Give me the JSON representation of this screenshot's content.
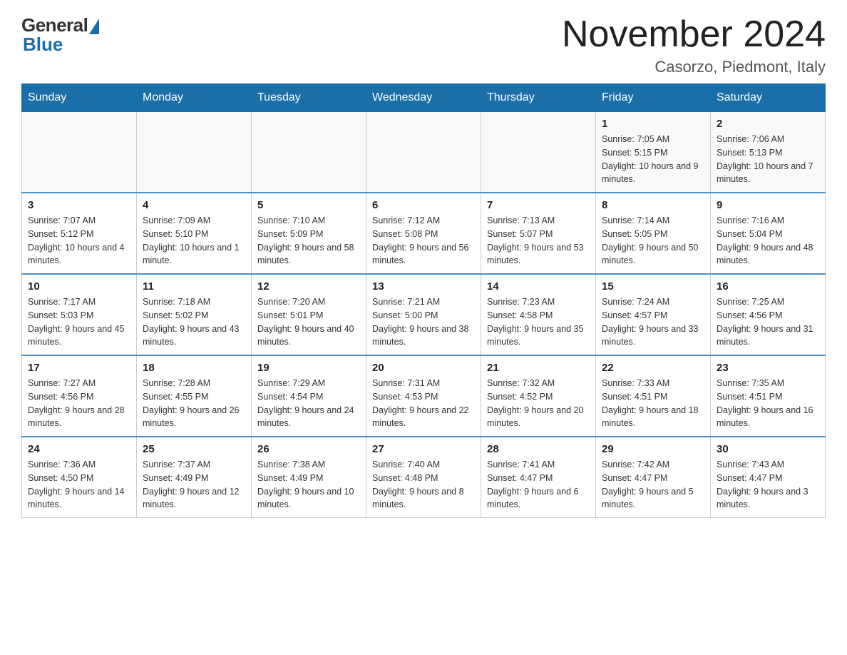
{
  "header": {
    "logo_general": "General",
    "logo_blue": "Blue",
    "month_title": "November 2024",
    "location": "Casorzo, Piedmont, Italy"
  },
  "weekdays": [
    "Sunday",
    "Monday",
    "Tuesday",
    "Wednesday",
    "Thursday",
    "Friday",
    "Saturday"
  ],
  "weeks": [
    [
      {
        "day": "",
        "info": ""
      },
      {
        "day": "",
        "info": ""
      },
      {
        "day": "",
        "info": ""
      },
      {
        "day": "",
        "info": ""
      },
      {
        "day": "",
        "info": ""
      },
      {
        "day": "1",
        "info": "Sunrise: 7:05 AM\nSunset: 5:15 PM\nDaylight: 10 hours and 9 minutes."
      },
      {
        "day": "2",
        "info": "Sunrise: 7:06 AM\nSunset: 5:13 PM\nDaylight: 10 hours and 7 minutes."
      }
    ],
    [
      {
        "day": "3",
        "info": "Sunrise: 7:07 AM\nSunset: 5:12 PM\nDaylight: 10 hours and 4 minutes."
      },
      {
        "day": "4",
        "info": "Sunrise: 7:09 AM\nSunset: 5:10 PM\nDaylight: 10 hours and 1 minute."
      },
      {
        "day": "5",
        "info": "Sunrise: 7:10 AM\nSunset: 5:09 PM\nDaylight: 9 hours and 58 minutes."
      },
      {
        "day": "6",
        "info": "Sunrise: 7:12 AM\nSunset: 5:08 PM\nDaylight: 9 hours and 56 minutes."
      },
      {
        "day": "7",
        "info": "Sunrise: 7:13 AM\nSunset: 5:07 PM\nDaylight: 9 hours and 53 minutes."
      },
      {
        "day": "8",
        "info": "Sunrise: 7:14 AM\nSunset: 5:05 PM\nDaylight: 9 hours and 50 minutes."
      },
      {
        "day": "9",
        "info": "Sunrise: 7:16 AM\nSunset: 5:04 PM\nDaylight: 9 hours and 48 minutes."
      }
    ],
    [
      {
        "day": "10",
        "info": "Sunrise: 7:17 AM\nSunset: 5:03 PM\nDaylight: 9 hours and 45 minutes."
      },
      {
        "day": "11",
        "info": "Sunrise: 7:18 AM\nSunset: 5:02 PM\nDaylight: 9 hours and 43 minutes."
      },
      {
        "day": "12",
        "info": "Sunrise: 7:20 AM\nSunset: 5:01 PM\nDaylight: 9 hours and 40 minutes."
      },
      {
        "day": "13",
        "info": "Sunrise: 7:21 AM\nSunset: 5:00 PM\nDaylight: 9 hours and 38 minutes."
      },
      {
        "day": "14",
        "info": "Sunrise: 7:23 AM\nSunset: 4:58 PM\nDaylight: 9 hours and 35 minutes."
      },
      {
        "day": "15",
        "info": "Sunrise: 7:24 AM\nSunset: 4:57 PM\nDaylight: 9 hours and 33 minutes."
      },
      {
        "day": "16",
        "info": "Sunrise: 7:25 AM\nSunset: 4:56 PM\nDaylight: 9 hours and 31 minutes."
      }
    ],
    [
      {
        "day": "17",
        "info": "Sunrise: 7:27 AM\nSunset: 4:56 PM\nDaylight: 9 hours and 28 minutes."
      },
      {
        "day": "18",
        "info": "Sunrise: 7:28 AM\nSunset: 4:55 PM\nDaylight: 9 hours and 26 minutes."
      },
      {
        "day": "19",
        "info": "Sunrise: 7:29 AM\nSunset: 4:54 PM\nDaylight: 9 hours and 24 minutes."
      },
      {
        "day": "20",
        "info": "Sunrise: 7:31 AM\nSunset: 4:53 PM\nDaylight: 9 hours and 22 minutes."
      },
      {
        "day": "21",
        "info": "Sunrise: 7:32 AM\nSunset: 4:52 PM\nDaylight: 9 hours and 20 minutes."
      },
      {
        "day": "22",
        "info": "Sunrise: 7:33 AM\nSunset: 4:51 PM\nDaylight: 9 hours and 18 minutes."
      },
      {
        "day": "23",
        "info": "Sunrise: 7:35 AM\nSunset: 4:51 PM\nDaylight: 9 hours and 16 minutes."
      }
    ],
    [
      {
        "day": "24",
        "info": "Sunrise: 7:36 AM\nSunset: 4:50 PM\nDaylight: 9 hours and 14 minutes."
      },
      {
        "day": "25",
        "info": "Sunrise: 7:37 AM\nSunset: 4:49 PM\nDaylight: 9 hours and 12 minutes."
      },
      {
        "day": "26",
        "info": "Sunrise: 7:38 AM\nSunset: 4:49 PM\nDaylight: 9 hours and 10 minutes."
      },
      {
        "day": "27",
        "info": "Sunrise: 7:40 AM\nSunset: 4:48 PM\nDaylight: 9 hours and 8 minutes."
      },
      {
        "day": "28",
        "info": "Sunrise: 7:41 AM\nSunset: 4:47 PM\nDaylight: 9 hours and 6 minutes."
      },
      {
        "day": "29",
        "info": "Sunrise: 7:42 AM\nSunset: 4:47 PM\nDaylight: 9 hours and 5 minutes."
      },
      {
        "day": "30",
        "info": "Sunrise: 7:43 AM\nSunset: 4:47 PM\nDaylight: 9 hours and 3 minutes."
      }
    ]
  ]
}
